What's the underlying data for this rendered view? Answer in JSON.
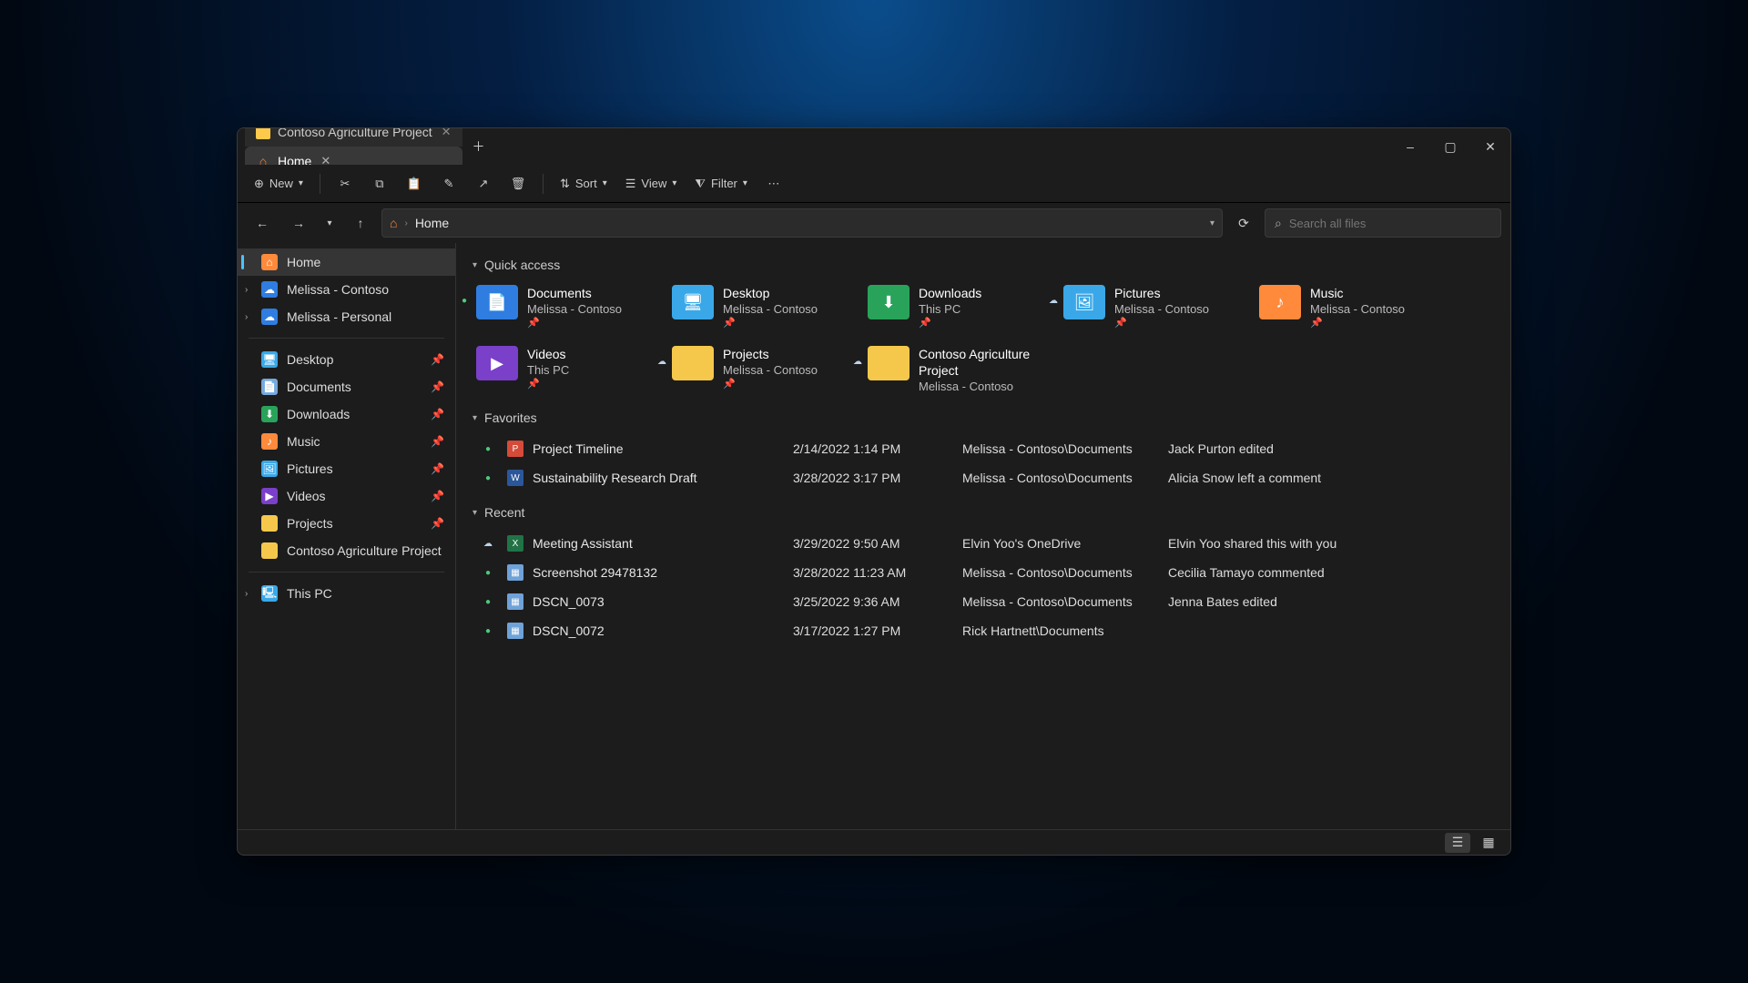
{
  "tabs": [
    {
      "label": "Contoso Agriculture Project",
      "active": false,
      "icon": "folder"
    },
    {
      "label": "Home",
      "active": true,
      "icon": "home"
    }
  ],
  "window_controls": {
    "minimize": "–",
    "maximize": "▢",
    "close": "✕"
  },
  "toolbar": {
    "new_label": "New",
    "sort_label": "Sort",
    "view_label": "View",
    "filter_label": "Filter"
  },
  "address": {
    "path": "Home"
  },
  "search": {
    "placeholder": "Search all files"
  },
  "sidebar": {
    "top": [
      {
        "label": "Home",
        "icon": "home",
        "selected": true
      },
      {
        "label": "Melissa - Contoso",
        "icon": "onedrive",
        "expandable": true
      },
      {
        "label": "Melissa - Personal",
        "icon": "onedrive",
        "expandable": true
      }
    ],
    "pinned": [
      {
        "label": "Desktop",
        "icon": "desktop"
      },
      {
        "label": "Documents",
        "icon": "documents"
      },
      {
        "label": "Downloads",
        "icon": "downloads"
      },
      {
        "label": "Music",
        "icon": "music"
      },
      {
        "label": "Pictures",
        "icon": "pictures"
      },
      {
        "label": "Videos",
        "icon": "videos"
      },
      {
        "label": "Projects",
        "icon": "folder"
      },
      {
        "label": "Contoso Agriculture Project",
        "icon": "folder",
        "nopin": true
      }
    ],
    "bottom": [
      {
        "label": "This PC",
        "icon": "pc",
        "expandable": true
      }
    ]
  },
  "sections": {
    "quick_access": "Quick access",
    "favorites": "Favorites",
    "recent": "Recent"
  },
  "quick_access": [
    {
      "name": "Documents",
      "sub": "Melissa - Contoso",
      "color": "c-blue",
      "glyph": "📄",
      "status": "sync"
    },
    {
      "name": "Desktop",
      "sub": "Melissa - Contoso",
      "color": "c-cyan",
      "glyph": "🖥"
    },
    {
      "name": "Downloads",
      "sub": "This PC",
      "color": "c-green",
      "glyph": "⬇"
    },
    {
      "name": "Pictures",
      "sub": "Melissa - Contoso",
      "color": "c-cyan",
      "glyph": "🖼",
      "status": "cloud"
    },
    {
      "name": "Music",
      "sub": "Melissa - Contoso",
      "color": "c-orange",
      "glyph": "♪"
    },
    {
      "name": "Videos",
      "sub": "This PC",
      "color": "c-purple",
      "glyph": "▶"
    },
    {
      "name": "Projects",
      "sub": "Melissa - Contoso",
      "color": "c-yellow2",
      "glyph": "",
      "status": "cloud"
    },
    {
      "name": "Contoso Agriculture Project",
      "sub": "Melissa - Contoso",
      "color": "c-yellow2",
      "glyph": "",
      "status": "cloud",
      "nopin": true
    }
  ],
  "favorites": [
    {
      "name": "Project Timeline",
      "date": "2/14/2022 1:14 PM",
      "loc": "Melissa - Contoso\\Documents",
      "activity": "Jack Purton edited",
      "ftype": "ppt",
      "status": "sync"
    },
    {
      "name": "Sustainability Research Draft",
      "date": "3/28/2022 3:17 PM",
      "loc": "Melissa - Contoso\\Documents",
      "activity": "Alicia Snow left a comment",
      "ftype": "word",
      "status": "sync"
    }
  ],
  "recent": [
    {
      "name": "Meeting Assistant",
      "date": "3/29/2022 9:50 AM",
      "loc": "Elvin Yoo's OneDrive",
      "activity": "Elvin Yoo shared this with you",
      "ftype": "excel",
      "status": "cloud"
    },
    {
      "name": "Screenshot 29478132",
      "date": "3/28/2022 11:23 AM",
      "loc": "Melissa - Contoso\\Documents",
      "activity": "Cecilia Tamayo commented",
      "ftype": "img",
      "status": "sync"
    },
    {
      "name": "DSCN_0073",
      "date": "3/25/2022 9:36 AM",
      "loc": "Melissa - Contoso\\Documents",
      "activity": "Jenna Bates edited",
      "ftype": "img",
      "status": "sync"
    },
    {
      "name": "DSCN_0072",
      "date": "3/17/2022 1:27 PM",
      "loc": "Rick Hartnett\\Documents",
      "activity": "",
      "ftype": "img",
      "status": "sync"
    }
  ]
}
